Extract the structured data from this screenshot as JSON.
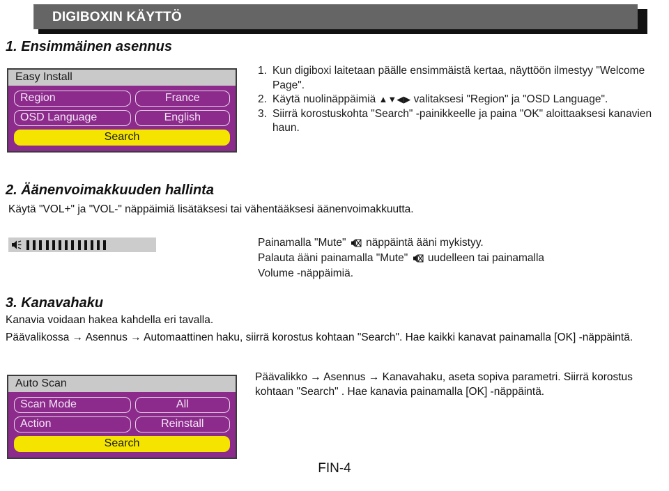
{
  "header": {
    "title": "DIGIBOXIN KÄYTTÖ",
    "bar_color": "#656565",
    "shadow_color": "#111111"
  },
  "footer": {
    "page_label": "FIN-4"
  },
  "sections": [
    {
      "id": "s1",
      "heading": "1. Ensimmäinen asennus",
      "steps": [
        {
          "num": "1.",
          "pre": "Kun digiboxi laitetaan päälle ensimmäistä kertaa, näyttöön ilmestyy \"Welcome Page\".",
          "arrows": "",
          "post": ""
        },
        {
          "num": "2.",
          "pre": "Käytä nuolinäppäimiä ",
          "arrows": "▲▼◀▶",
          "post": " valitaksesi \"Region\" ja \"OSD Language\"."
        },
        {
          "num": "3.",
          "pre": "Siirrä korostuskohta \"Search\" -painikkeelle ja paina \"OK\" aloittaaksesi kanavien haun.",
          "arrows": "",
          "post": ""
        }
      ]
    },
    {
      "id": "s2",
      "heading": "2. Äänenvoimakkuuden hallinta",
      "paragraph": "Käytä \"VOL+\" ja \"VOL-\" näppäimiä lisätäksesi tai vähentääksesi äänenvoimakkuutta.",
      "mute_lines": {
        "line1_a": "Painamalla \"Mute\" ",
        "line1_b": " näppäintä ääni mykistyy.",
        "line2_a": "Palauta ääni painamalla \"Mute\" ",
        "line2_b": " uudelleen tai painamalla",
        "line3": "Volume -näppäimiä."
      }
    },
    {
      "id": "s3",
      "heading": "3. Kanavahaku",
      "paragraph1": "Kanavia voidaan hakea kahdella eri tavalla.",
      "paragraph2": "Päävalikossa → Asennus → Automaattinen haku, siirrä korostus kohtaan \"Search\". Hae kaikki kanavat painamalla [OK] -näppäintä.",
      "paragraph3": "Päävalikko → Asennus → Kanavahaku, aseta sopiva parametri. Siirrä korostus kohtaan \"Search\" . Hae kanavia painamalla [OK] -näppäintä."
    }
  ],
  "osd_easy_install": {
    "title": "Easy Install",
    "rows": [
      {
        "label": "Region",
        "value": "France"
      },
      {
        "label": "OSD Language",
        "value": "English"
      }
    ],
    "search_label": "Search",
    "colors": {
      "bg": "#8d2b8d",
      "title_bg": "#c9c9c9",
      "search_bg": "#f5e400",
      "text": "#f2e6f5"
    }
  },
  "osd_auto_scan": {
    "title": "Auto Scan",
    "rows": [
      {
        "label": "Scan Mode",
        "value": "All"
      },
      {
        "label": "Action",
        "value": "Reinstall"
      }
    ],
    "search_label": "Search",
    "colors": {
      "bg": "#8d2b8d",
      "title_bg": "#c9c9c9",
      "search_bg": "#f5e400",
      "text": "#f2e6f5"
    }
  },
  "volume_indicator": {
    "icon": "speaker-icon",
    "segments_total": 13,
    "segments_filled": 13,
    "bg_color": "#cccccc",
    "segment_color": "#111111"
  }
}
